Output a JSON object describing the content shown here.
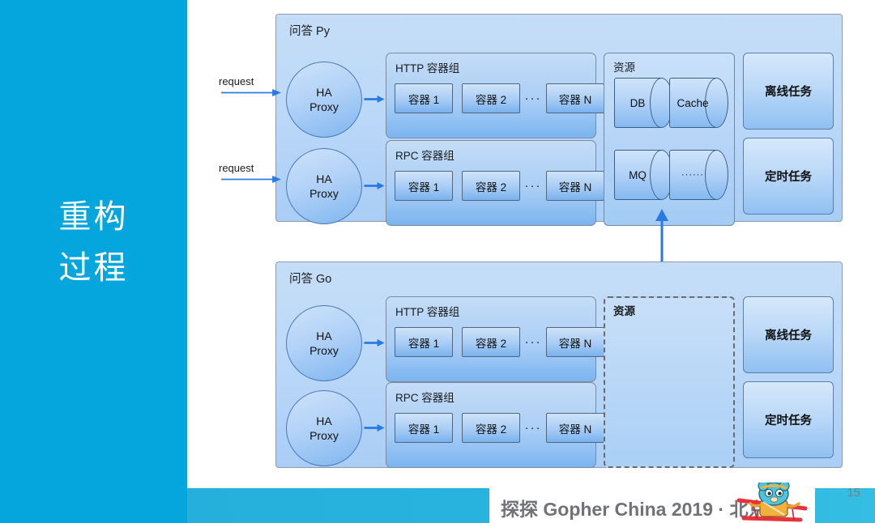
{
  "slide": {
    "title_lines": [
      "重构",
      "过程"
    ],
    "accent_color": "#05a6dd",
    "page_number": "15"
  },
  "footer": {
    "brand_text": "探探 Gopher China 2019 · 北京",
    "mascot_icon": "gopher-mascot-icon",
    "band_color": "#29b4de"
  },
  "diagram": {
    "systems": [
      {
        "name": "问答 Py",
        "requests": [
          {
            "label": "request",
            "icon": "arrow-right-icon"
          },
          {
            "label": "request",
            "icon": "arrow-right-icon"
          }
        ],
        "proxies": [
          {
            "line1": "HA",
            "line2": "Proxy"
          },
          {
            "line1": "HA",
            "line2": "Proxy"
          }
        ],
        "pods": [
          {
            "label": "HTTP 容器组",
            "containers": [
              "容器 1",
              "容器 2",
              "容器 N"
            ],
            "ellipsis": "···"
          },
          {
            "label": "RPC 容器组",
            "containers": [
              "容器 1",
              "容器 2",
              "容器 N"
            ],
            "ellipsis": "···"
          }
        ],
        "resource": {
          "label": "资源",
          "style": "solid",
          "nodes": [
            "DB",
            "Cache",
            "MQ",
            "······"
          ]
        },
        "tasks": [
          "离线任务",
          "定时任务"
        ]
      },
      {
        "name": "问答 Go",
        "requests": [],
        "proxies": [
          {
            "line1": "HA",
            "line2": "Proxy"
          },
          {
            "line1": "HA",
            "line2": "Proxy"
          }
        ],
        "pods": [
          {
            "label": "HTTP 容器组",
            "containers": [
              "容器 1",
              "容器 2",
              "容器 N"
            ],
            "ellipsis": "···"
          },
          {
            "label": "RPC 容器组",
            "containers": [
              "容器 1",
              "容器 2",
              "容器 N"
            ],
            "ellipsis": "···"
          }
        ],
        "resource": {
          "label": "资源",
          "style": "dashed",
          "nodes": []
        },
        "tasks": [
          "离线任务",
          "定时任务"
        ]
      }
    ],
    "link": {
      "icon": "arrow-up-icon",
      "color": "#2a7ae4"
    }
  }
}
